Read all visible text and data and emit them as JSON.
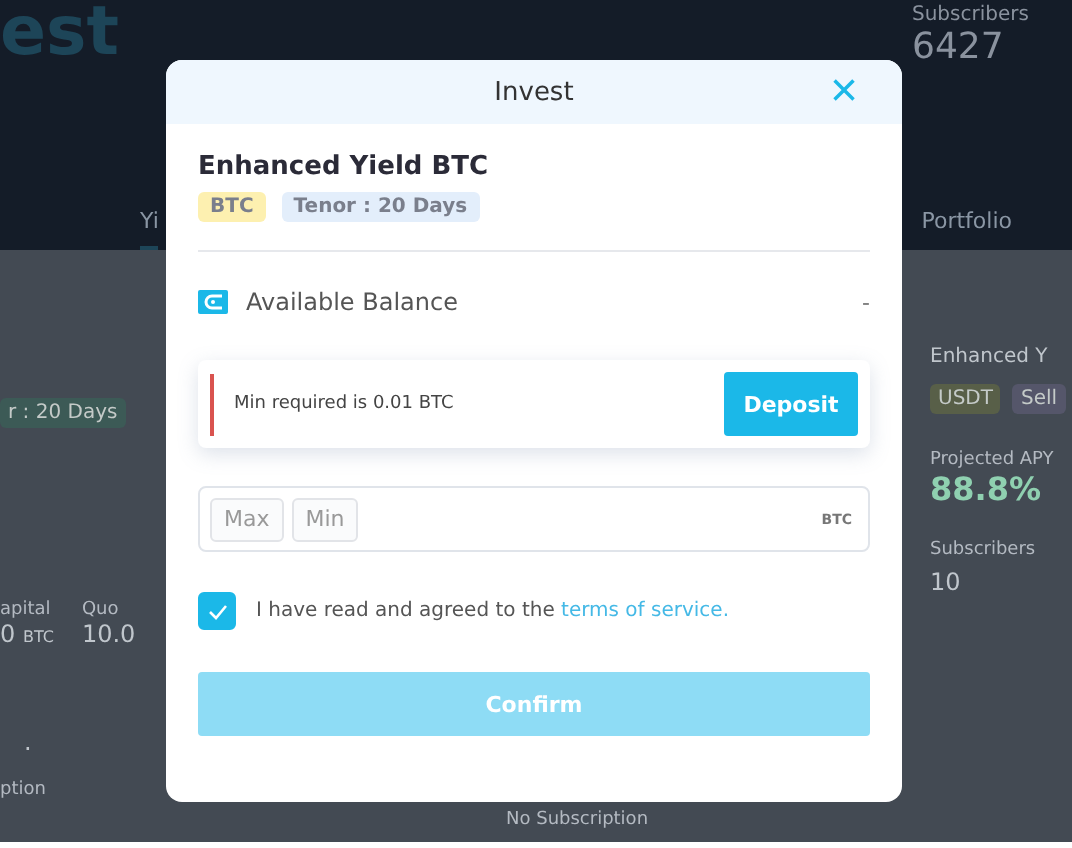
{
  "background": {
    "heading": "est",
    "stats": [
      {
        "label": "Subscribers",
        "value": "6427"
      }
    ],
    "tabs": [
      {
        "label": "Yi",
        "selected": true
      },
      {
        "label": "Portfolio",
        "selected": false
      }
    ],
    "left_card": {
      "badge": "r : 20 Days",
      "fields": [
        {
          "label": "apital",
          "value": "0",
          "unit": "BTC"
        },
        {
          "label": "Quo",
          "value": "10.0"
        }
      ],
      "dot": ".",
      "footer": "ption"
    },
    "middle_card": {
      "footer": "No Subscription"
    },
    "right_card": {
      "title": "Enhanced Y",
      "badges": [
        "USDT",
        "Sell"
      ],
      "apy_label": "Projected APY",
      "apy": "88.8%",
      "subscribers_label": "Subscribers",
      "subscribers": "10"
    }
  },
  "modal": {
    "title": "Invest",
    "close": "×",
    "product": {
      "name": "Enhanced Yield BTC",
      "tags": [
        {
          "label": "BTC",
          "color": "#fdf0b0"
        },
        {
          "label": "Tenor : 20 Days",
          "color": "#e3eefb"
        }
      ]
    },
    "balance": {
      "label": "Available Balance",
      "value": "-"
    },
    "alert": {
      "message": "Min required is 0.01 BTC",
      "action": "Deposit"
    },
    "amount": {
      "quick": [
        "Max",
        "Min"
      ],
      "unit": "BTC"
    },
    "agreement": {
      "checked": true,
      "text": "I have read and agreed to the ",
      "link": "terms of service."
    },
    "confirm": {
      "label": "Confirm",
      "disabled": true
    }
  }
}
